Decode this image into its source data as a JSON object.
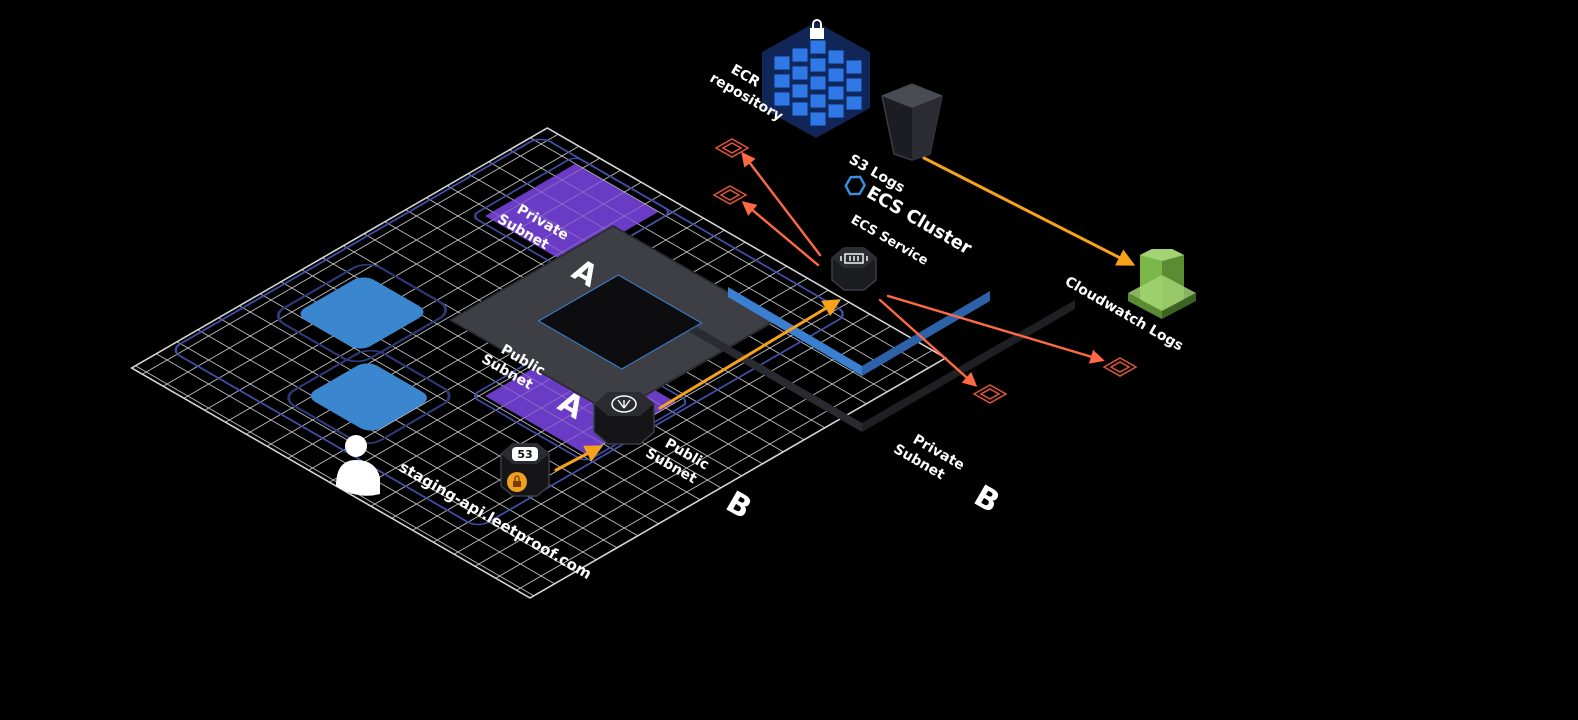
{
  "labels": {
    "ecr_repository": [
      "ECR",
      "repository"
    ],
    "s3_logs": "S3 Logs",
    "ecs_cluster": "ECS Cluster",
    "ecs_service": "ECS Service",
    "cloudwatch_logs": "Cloudwatch Logs",
    "private_subnet_a": [
      "Private",
      "Subnet"
    ],
    "private_subnet_a_letter": "A",
    "private_subnet_b": [
      "Private",
      "Subnet"
    ],
    "private_subnet_b_letter": "B",
    "public_subnet_a": [
      "Public",
      "Subnet"
    ],
    "public_subnet_a_letter": "A",
    "public_subnet_b": [
      "Public",
      "Subnet"
    ],
    "public_subnet_b_letter": "B",
    "route53_badge": "53",
    "domain": "staging-api.leetproof.com"
  },
  "colors": {
    "background": "#000000",
    "grid_line": "#d9d9d9",
    "private_subnet": "#6a3bc4",
    "public_subnet": "#3a87cf",
    "cluster_frame": "#3d3f45",
    "service_plate": "#0d0d10",
    "service_edge": "#3a7fd0",
    "arrow_orange": "#f7a21b",
    "arrow_red": "#ff6a45",
    "task_icon": "#e0573c",
    "ecr_blue": "#2f78e6",
    "cloudwatch_green": "#7ab648",
    "vpc_outline": "#4150a8"
  }
}
